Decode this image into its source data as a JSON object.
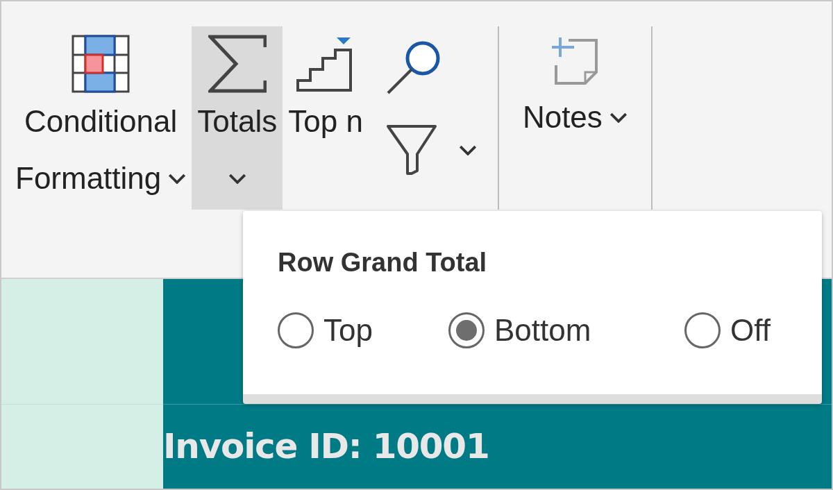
{
  "ribbon": {
    "buttons": [
      {
        "kind": "conditional-formatting",
        "lines": [
          "Conditional",
          "Formatting"
        ],
        "dropdown": true,
        "selected": false
      },
      {
        "kind": "totals",
        "lines": [
          "Totals"
        ],
        "dropdown": true,
        "selected": true
      },
      {
        "kind": "top-n",
        "lines": [
          "Top n"
        ],
        "dropdown": false,
        "selected": false
      },
      {
        "kind": "search-filter",
        "dropdown": true,
        "selected": false
      },
      {
        "kind": "notes",
        "lines": [
          "Notes"
        ],
        "dropdown": true,
        "selected": false
      }
    ]
  },
  "popup": {
    "title": "Row Grand Total",
    "options": [
      {
        "label": "Top",
        "selected": false
      },
      {
        "label": "Bottom",
        "selected": true
      },
      {
        "label": "Off",
        "selected": false
      }
    ]
  },
  "grid": {
    "row_label": "Invoice ID: 10001"
  }
}
